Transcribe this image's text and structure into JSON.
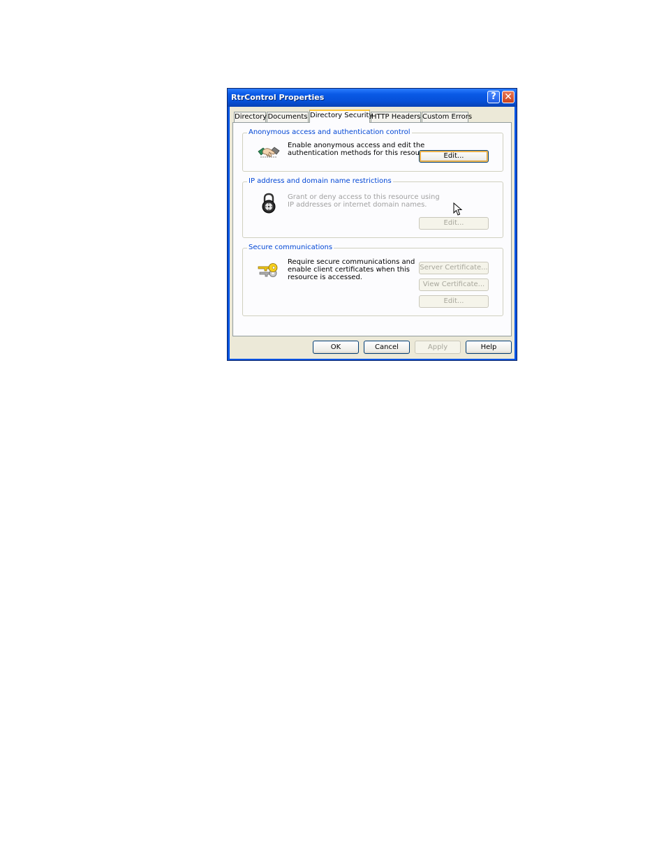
{
  "window": {
    "title": "RtrControl Properties",
    "help_icon": "?",
    "close_icon": "✕"
  },
  "tabs": [
    {
      "label": "Directory",
      "active": false
    },
    {
      "label": "Documents",
      "active": false
    },
    {
      "label": "Directory Security",
      "active": true
    },
    {
      "label": "HTTP Headers",
      "active": false
    },
    {
      "label": "Custom Errors",
      "active": false
    }
  ],
  "anonymous": {
    "group_label": "Anonymous access and authentication control",
    "description": "Enable anonymous access and edit the\nauthentication methods for this resource.",
    "edit_label": "Edit...",
    "icon": "handshake-icon"
  },
  "ip": {
    "group_label": "IP address and domain name restrictions",
    "description": "Grant or deny access to this resource using\nIP addresses or internet domain names.",
    "edit_label": "Edit...",
    "icon": "padlock-icon"
  },
  "secure": {
    "group_label": "Secure communications",
    "description": "Require secure communications and\nenable client certificates when this\nresource is accessed.",
    "server_cert_label": "Server Certificate...",
    "view_cert_label": "View Certificate...",
    "edit_label": "Edit...",
    "icon": "keys-icon"
  },
  "buttons": {
    "ok": "OK",
    "cancel": "Cancel",
    "apply": "Apply",
    "help": "Help"
  },
  "colors": {
    "titlebar": "#0054e3",
    "group_label": "#0046d5",
    "face": "#ece9d8"
  }
}
